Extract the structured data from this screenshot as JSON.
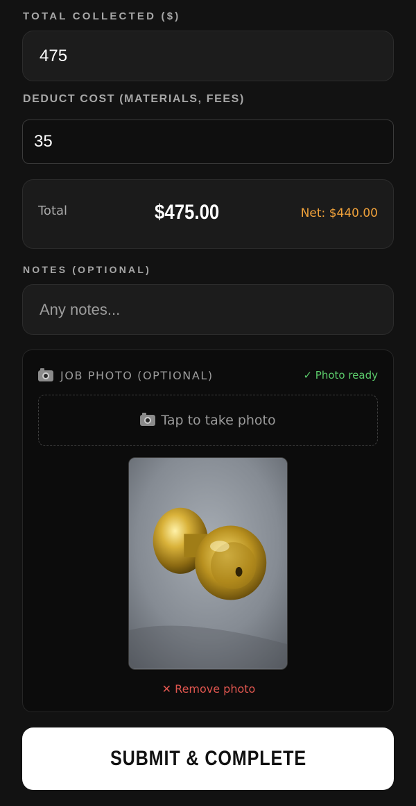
{
  "form": {
    "total_collected": {
      "label": "TOTAL COLLECTED ($)",
      "value": "475"
    },
    "deduct_cost": {
      "label": "DEDUCT COST (MATERIALS, FEES)",
      "value": "35"
    },
    "summary": {
      "label": "Total",
      "total": "$475.00",
      "net": "Net: $440.00"
    },
    "notes": {
      "label": "NOTES (OPTIONAL)",
      "placeholder": "Any notes..."
    },
    "photo": {
      "label": "JOB PHOTO (OPTIONAL)",
      "status": "✓ Photo ready",
      "tap_label": "Tap to take photo",
      "remove_label": "✕ Remove photo"
    },
    "submit_label": "SUBMIT & COMPLETE"
  },
  "colors": {
    "background": "#121212",
    "net_accent": "#f1a23a",
    "ready_green": "#5bcb6b",
    "remove_red": "#e0564f"
  },
  "icons": {
    "photo_header": "camera-icon",
    "tap_zone": "camera-icon"
  }
}
